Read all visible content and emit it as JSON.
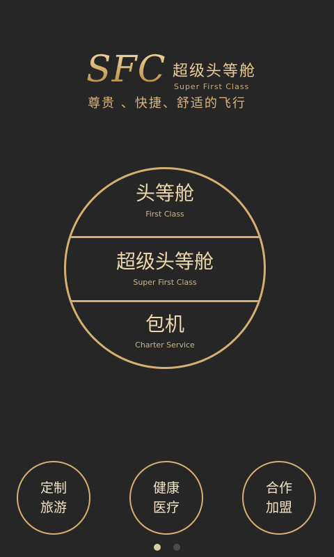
{
  "logo": {
    "mark": "SFC",
    "name_cn": "超级头等舱",
    "name_en": "Super First Class",
    "slogan": "尊贵 、快捷、舒适的飞行"
  },
  "menu": {
    "sections": [
      {
        "cn": "头等舱",
        "en": "First Class"
      },
      {
        "cn": "超级头等舱",
        "en": "Super First Class"
      },
      {
        "cn": "包机",
        "en": "Charter Service"
      }
    ]
  },
  "bottom_buttons": [
    {
      "line1": "定制",
      "line2": "旅游"
    },
    {
      "line1": "健康",
      "line2": "医疗"
    },
    {
      "line1": "合作",
      "line2": "加盟"
    }
  ],
  "pager": {
    "pages": 2,
    "current": 1
  },
  "colors": {
    "background": "#262626",
    "gold": "#d6b071",
    "text": "#ecd7ac"
  }
}
